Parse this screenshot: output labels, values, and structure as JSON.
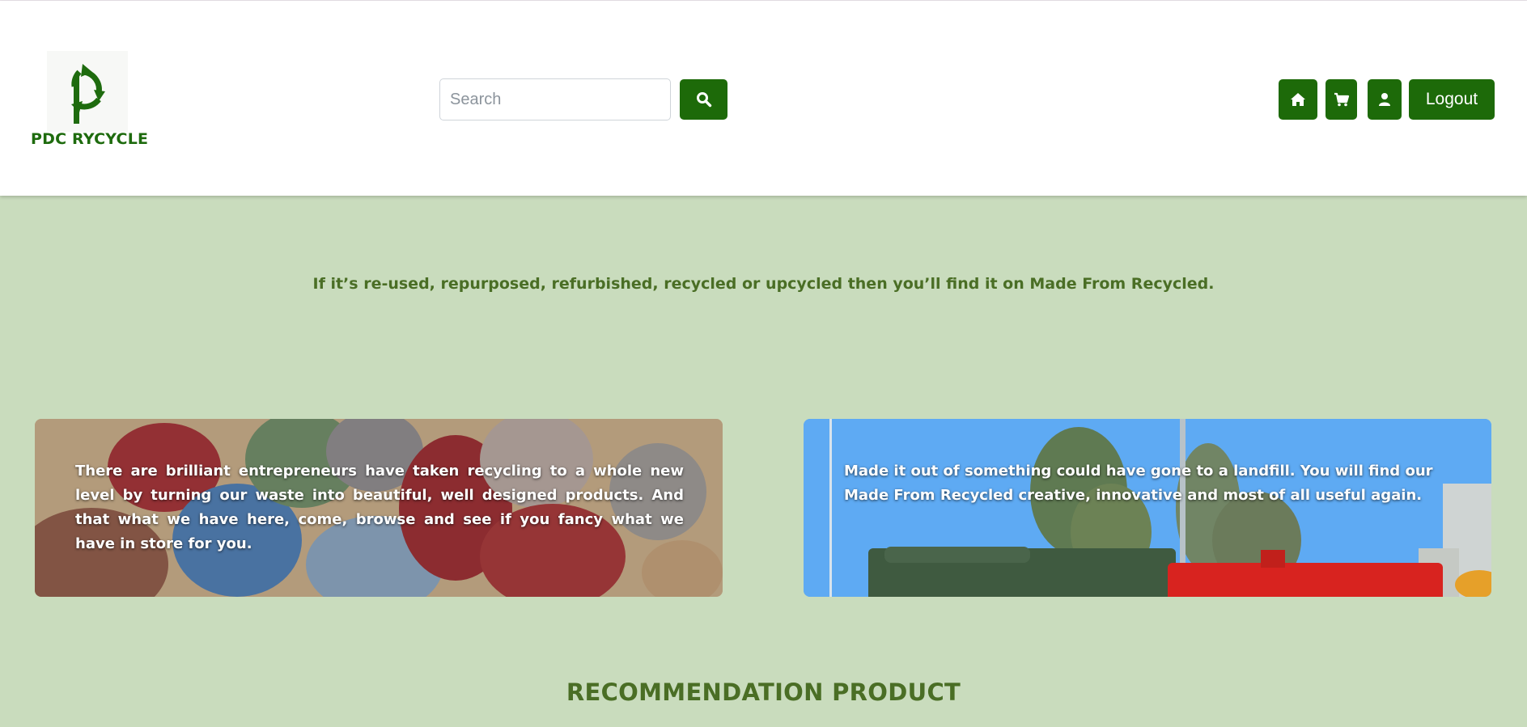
{
  "brand": {
    "name": "PDC RYCYCLE",
    "color": "#1e6b0e",
    "logo_icon": "recycle-p-icon"
  },
  "header": {
    "search": {
      "placeholder": "Search",
      "value": "",
      "button_icon": "search-icon"
    },
    "nav": {
      "home_icon": "home-icon",
      "cart_icon": "cart-icon",
      "user_icon": "user-icon",
      "logout_label": "Logout"
    },
    "button_color": "#1d6a09"
  },
  "hero": {
    "tagline": "If it’s re-used, repurposed, refurbished, recycled or upcycled then you’ll find it on Made From Recycled."
  },
  "cards": [
    {
      "image": "woven-recycled-baskets-photo",
      "text": "There are brilliant entrepreneurs have taken recycling to a whole new level by turning our waste into beautiful, well designed products. And that what we have here, come, browse and see if you fancy what we have in store for you."
    },
    {
      "image": "recycling-bins-photo",
      "text": "Made it out of something could have gone to a landfill. You will find our Made From Recycled creative, innovative and most of all useful again."
    }
  ],
  "recommendation": {
    "title": "RECOMMENDATION PRODUCT"
  },
  "colors": {
    "page_bg": "#c9dcbd",
    "heading": "#4a6e25"
  }
}
